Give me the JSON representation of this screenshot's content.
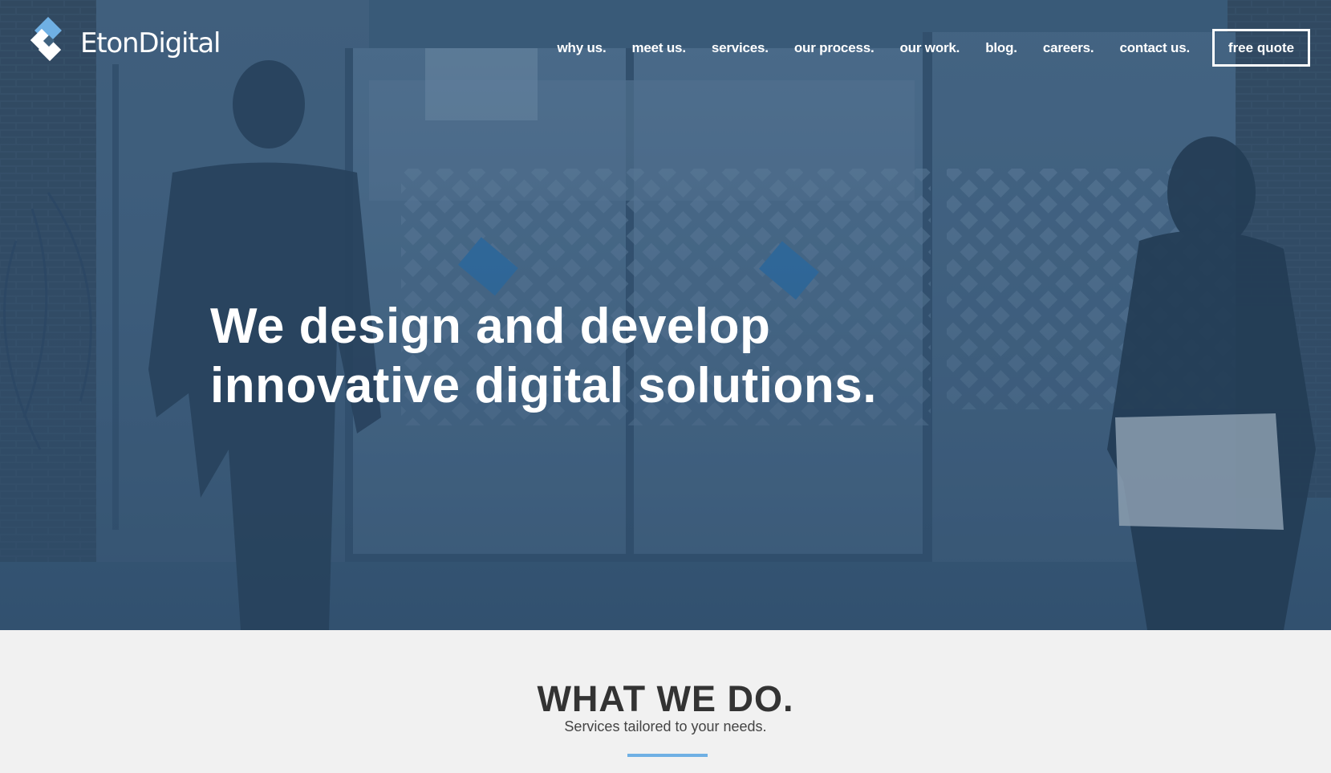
{
  "brand": {
    "name": "EtonDigital",
    "logo_icon": "eton-diamond-logo-icon",
    "accent_color": "#6fb0e4"
  },
  "nav": {
    "items": [
      "why us.",
      "meet us.",
      "services.",
      "our process.",
      "our work.",
      "blog.",
      "careers.",
      "contact us."
    ],
    "cta": "free quote"
  },
  "hero": {
    "line1": "We design and develop",
    "line2": "innovative digital solutions.",
    "overlay_color": "#3b5a7a"
  },
  "section": {
    "title": "WHAT WE DO.",
    "subtitle": "Services tailored to your needs."
  }
}
